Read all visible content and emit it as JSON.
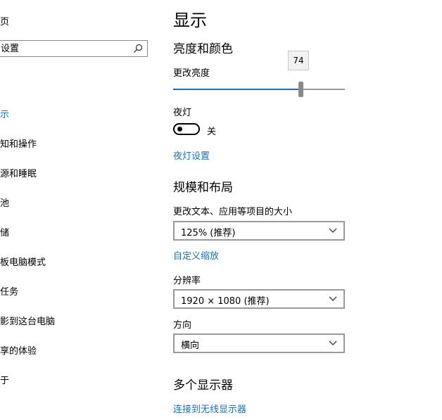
{
  "nav": {
    "top_item": "页",
    "search_placeholder": "设置",
    "items": [
      {
        "label": "示",
        "active": true
      },
      {
        "label": "知和操作"
      },
      {
        "label": "源和睡眠"
      },
      {
        "label": "池"
      },
      {
        "label": "储"
      },
      {
        "label": "板电脑模式"
      },
      {
        "label": "任务"
      },
      {
        "label": "影到这台电脑"
      },
      {
        "label": "享的体验"
      },
      {
        "label": "于"
      }
    ]
  },
  "page": {
    "title": "显示"
  },
  "brightness": {
    "heading": "亮度和颜色",
    "label": "更改亮度",
    "value": 74,
    "value_text": "74"
  },
  "night_light": {
    "label": "夜灯",
    "state": "关",
    "settings_link": "夜灯设置"
  },
  "scale": {
    "heading": "规模和布局",
    "label": "更改文本、应用等项目的大小",
    "selected": "125% (推荐)",
    "custom_link": "自定义缩放"
  },
  "resolution": {
    "label": "分辨率",
    "selected": "1920 × 1080 (推荐)"
  },
  "orientation": {
    "label": "方向",
    "selected": "横向"
  },
  "multi_display": {
    "heading": "多个显示器",
    "wireless_link": "连接到无线显示器"
  },
  "colors": {
    "accent": "#1f6fb0"
  }
}
